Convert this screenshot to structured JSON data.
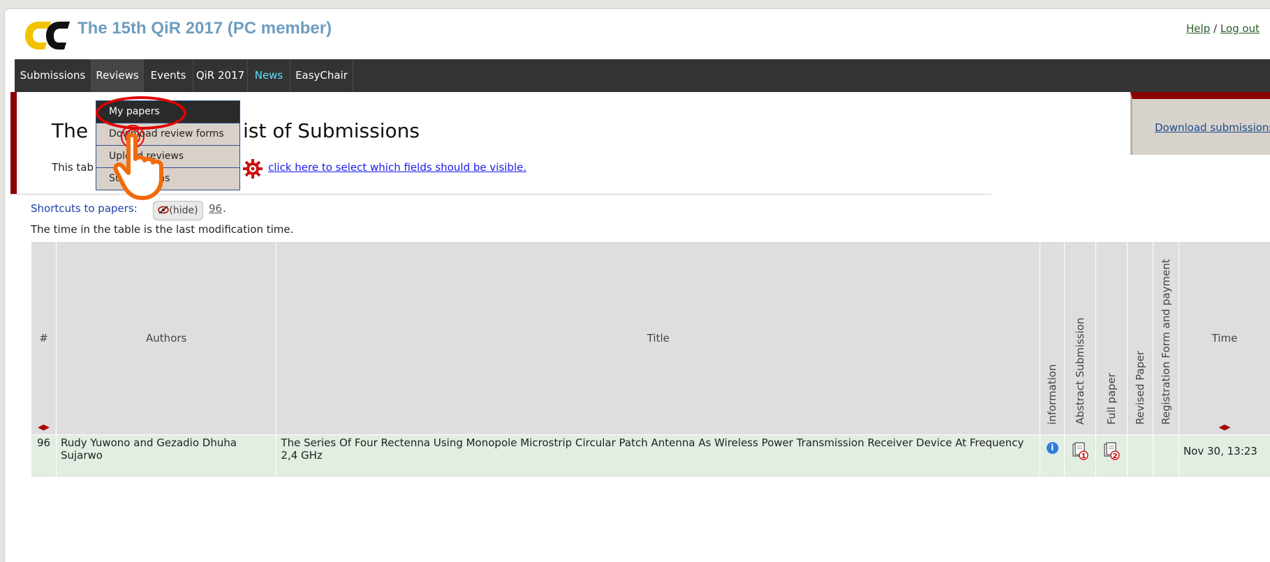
{
  "header": {
    "conference_title": "The 15th QiR 2017 (PC member)",
    "help_label": "Help",
    "separator": "/",
    "logout_label": "Log out"
  },
  "nav": {
    "items": [
      {
        "label": "Submissions"
      },
      {
        "label": "Reviews"
      },
      {
        "label": "Events"
      },
      {
        "label": "QiR 2017"
      },
      {
        "label": "News"
      },
      {
        "label": "EasyChair"
      }
    ]
  },
  "dropdown": {
    "items": [
      {
        "label": "My papers"
      },
      {
        "label": "Download review forms"
      },
      {
        "label": "Upload reviews"
      },
      {
        "label": "Submissions"
      }
    ]
  },
  "page": {
    "title_left": "The",
    "title_right": "ist of Submissions",
    "table_note_prefix": "This tab",
    "fields_link": "click here to select which fields should be visible.",
    "download_submissions": "Download submissions",
    "shortcuts_label": "Shortcuts to papers:",
    "hide_label": "(hide)",
    "shortcut_paper": "96",
    "shortcut_tail": ".",
    "time_note": "The time in the table is the last modification time."
  },
  "table": {
    "columns": {
      "num": "#",
      "authors": "Authors",
      "title": "Title",
      "information": "information",
      "abstract": "Abstract Submission",
      "full_paper": "Full paper",
      "revised": "Revised Paper",
      "registration": "Registration Form and payment",
      "time": "Time"
    },
    "rows": [
      {
        "num": "96",
        "authors": "Rudy Yuwono and Gezadio Dhuha Sujarwo",
        "title": "The Series Of Four Rectenna Using Monopole Microstrip Circular Patch Antenna As Wireless Power Transmission Receiver Device At Frequency 2,4 GHz",
        "abstract_version": "1",
        "full_paper_version": "2",
        "time": "Nov 30, 13:23"
      }
    ]
  },
  "colors": {
    "nav_bg": "#333333",
    "accent_red": "#8b0000",
    "news_color": "#5fe0ff",
    "row_bg": "#e1eee1"
  }
}
